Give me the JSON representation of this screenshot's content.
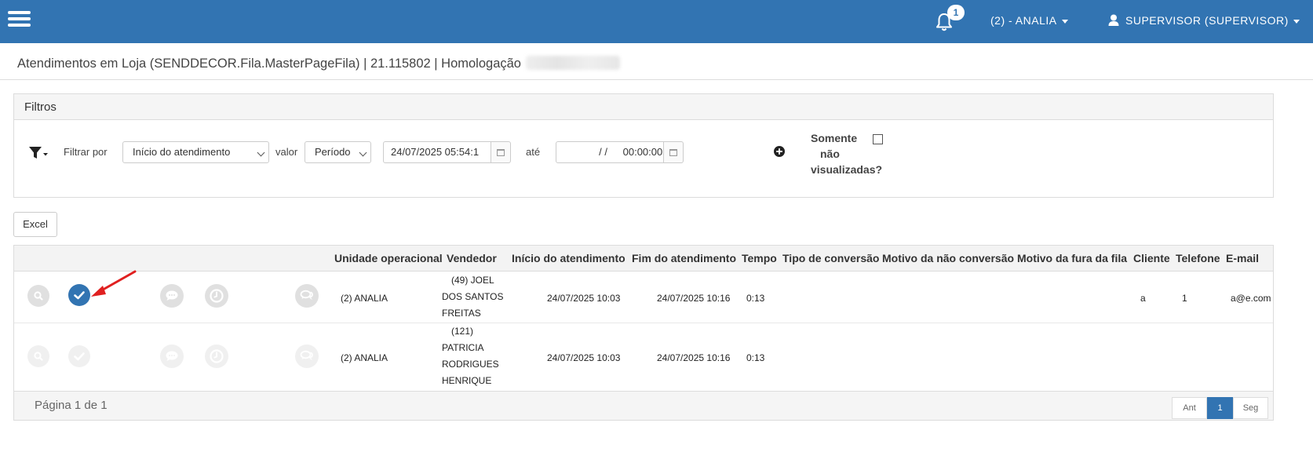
{
  "header": {
    "notifications_count": "1",
    "unit_label": "(2) - ANALIA",
    "user_label": "SUPERVISOR (SUPERVISOR)"
  },
  "page": {
    "title": "Atendimentos em Loja (SENDDECOR.Fila.MasterPageFila) | 21.115802 | Homologação"
  },
  "filters": {
    "panel_title": "Filtros",
    "filter_by_label": "Filtrar por",
    "filter_field_selected": "Início do atendimento",
    "value_label": "valor",
    "value_mode_selected": "Período",
    "date_from": "24/07/2025 05:54:1",
    "until_label": "até",
    "date_to_date": "/  /",
    "date_to_time": "00:00:00",
    "only_unviewed_label_1": "Somente",
    "only_unviewed_label_2": "não",
    "only_unviewed_label_3": "visualizadas?",
    "only_unviewed_checked": false
  },
  "actions": {
    "excel_label": "Excel"
  },
  "table": {
    "columns": [
      "Unidade operacional",
      "Vendedor",
      "Início do atendimento",
      "Fim do atendimento",
      "Tempo",
      "Tipo de conversão",
      "Motivo da não conversão",
      "Motivo da fura da fila",
      "Cliente",
      "Telefone",
      "E-mail"
    ],
    "rows": [
      {
        "unidade": "(2) ANALIA",
        "vendedor_1": "(49) JOEL",
        "vendedor_2": "DOS SANTOS",
        "vendedor_3": "FREITAS",
        "vendedor_4": "",
        "inicio": "24/07/2025 10:03",
        "fim": "24/07/2025 10:16",
        "tempo": "0:13",
        "tipo_conversao": "",
        "motivo_nao_conversao": "",
        "motivo_fura_fila": "",
        "cliente": "a",
        "telefone": "1",
        "email": "a@e.com",
        "checked_active": true
      },
      {
        "unidade": "(2) ANALIA",
        "vendedor_1": "(121)",
        "vendedor_2": "PATRICIA",
        "vendedor_3": "RODRIGUES",
        "vendedor_4": "HENRIQUE",
        "inicio": "24/07/2025 10:03",
        "fim": "24/07/2025 10:16",
        "tempo": "0:13",
        "tipo_conversao": "",
        "motivo_nao_conversao": "",
        "motivo_fura_fila": "",
        "cliente": "",
        "telefone": "",
        "email": "",
        "checked_active": false
      }
    ]
  },
  "pagination": {
    "info": "Página 1 de 1",
    "prev_label": "Ant",
    "current_page": "1",
    "next_label": "Seg"
  },
  "colors": {
    "brand_blue": "#3274b2",
    "annotation_arrow": "#e02020"
  },
  "icons": {
    "menu": "hamburger-icon",
    "notifications": "bell-icon",
    "user": "user-icon",
    "filter": "funnel-icon",
    "add_filter": "plus-circle-icon",
    "row_actions": [
      "search-icon",
      "check-icon",
      "comment-icon",
      "clock-icon",
      "chat-icon"
    ]
  }
}
